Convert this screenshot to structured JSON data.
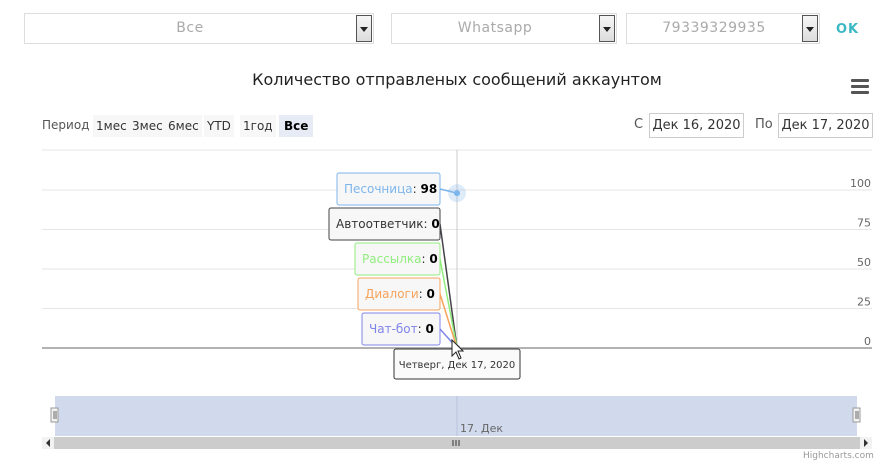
{
  "filters": {
    "group": "Все",
    "channel": "Whatsapp",
    "phone": "79339329935",
    "ok_label": "OK"
  },
  "range_selector": {
    "label": "Период",
    "buttons": [
      "1мес",
      "3мес",
      "6мес",
      "YTD",
      "1год",
      "Все"
    ],
    "active": "Все",
    "from_label": "С",
    "from_value": "Дек 16, 2020",
    "to_label": "По",
    "to_value": "Дек 17, 2020"
  },
  "navigator": {
    "label": "17. Дек"
  },
  "credits": "Highcharts.com",
  "colors": {
    "accent": "#3cb8c3",
    "Песочница": "#7cb5ec",
    "Автоответчик": "#434348",
    "Рассылка": "#90ed7d",
    "Диалоги": "#f7a35c",
    "Чат-бот": "#8085e9"
  },
  "tooltip": {
    "date": "Четверг, Дек 17, 2020",
    "items": [
      {
        "name": "Песочница",
        "value": "98"
      },
      {
        "name": "Автоответчик",
        "value": "0"
      },
      {
        "name": "Рассылка",
        "value": "0"
      },
      {
        "name": "Диалоги",
        "value": "0"
      },
      {
        "name": "Чат-бот",
        "value": "0"
      }
    ]
  },
  "chart_data": {
    "type": "line",
    "title": "Количество отправленых сообщений аккаунтом",
    "x": [
      "Дек 17, 2020"
    ],
    "yticks": [
      0,
      25,
      50,
      75,
      100
    ],
    "ylim": [
      0,
      100
    ],
    "grid": true,
    "legend": "none",
    "series": [
      {
        "name": "Песочница",
        "values": [
          98
        ]
      },
      {
        "name": "Автоответчик",
        "values": [
          0
        ]
      },
      {
        "name": "Рассылка",
        "values": [
          0
        ]
      },
      {
        "name": "Диалоги",
        "values": [
          0
        ]
      },
      {
        "name": "Чат-бот",
        "values": [
          0
        ]
      }
    ]
  }
}
